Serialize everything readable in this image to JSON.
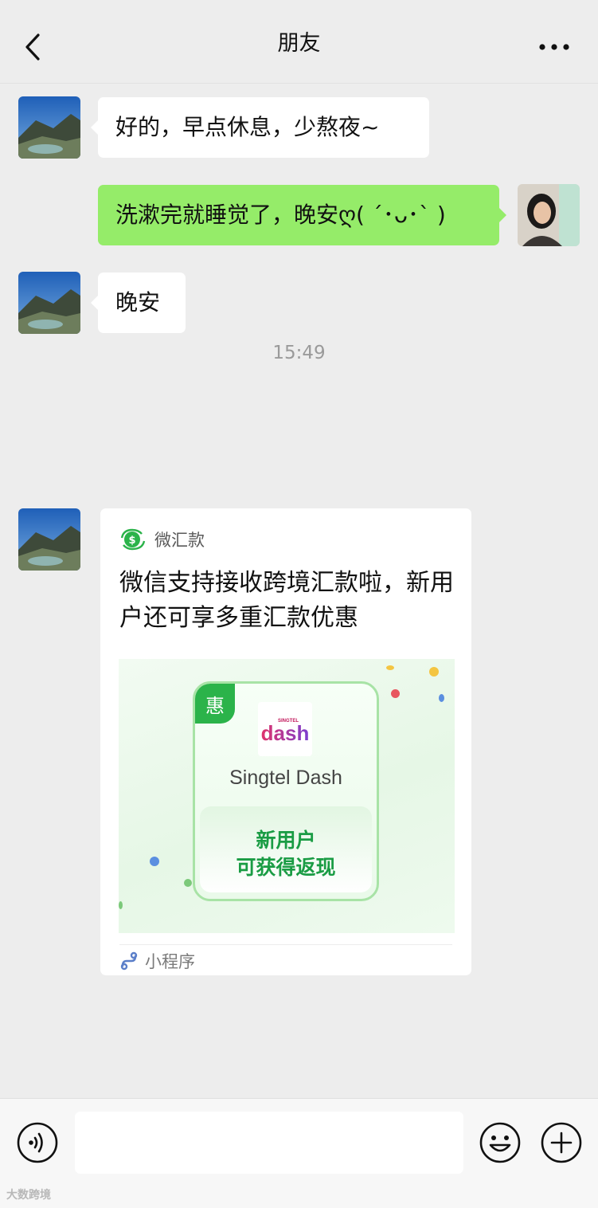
{
  "header": {
    "title": "朋友",
    "back_icon": "chevron-left-icon",
    "more_icon": "more-dots-icon"
  },
  "messages": [
    {
      "side": "left",
      "text": "好的，早点休息，少熬夜~"
    },
    {
      "side": "right",
      "text": "洗漱完就睡觉了，晚安ღ( ´･ᴗ･` )"
    },
    {
      "side": "left",
      "text": "晚安"
    }
  ],
  "timestamp": "15:49",
  "card": {
    "source_label": "微汇款",
    "title": "微信支持接收跨境汇款啦，新用户还可享多重汇款优惠",
    "banner": {
      "badge": "惠",
      "logo_small": "SINGTEL",
      "logo_text": "dash",
      "brand": "Singtel Dash",
      "offer_line1": "新用户",
      "offer_line2": "可获得返现"
    },
    "footer_label": "小程序"
  },
  "input": {
    "placeholder": ""
  },
  "watermark": "大数跨境",
  "colors": {
    "background": "#ededed",
    "bubble_mine": "#95ec69",
    "bubble_other": "#ffffff",
    "accent_green": "#2bb34a"
  }
}
